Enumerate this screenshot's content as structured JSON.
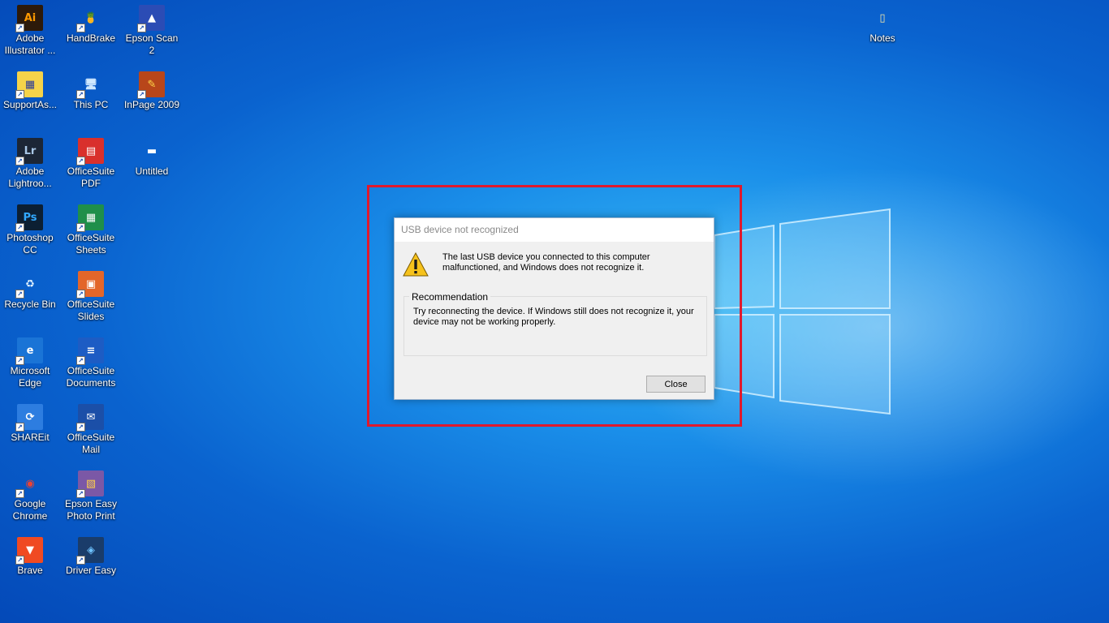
{
  "desktop": {
    "icons": [
      {
        "label": "Adobe Illustrator ...",
        "icon": "illustrator-icon",
        "glyph": "Ai",
        "color": "#2d1a0a",
        "fg": "#ff9a00"
      },
      {
        "label": "HandBrake",
        "icon": "handbrake-icon",
        "glyph": "🍍",
        "color": "transparent",
        "fg": "#e0a020"
      },
      {
        "label": "Epson Scan 2",
        "icon": "scanner-icon",
        "glyph": "▲",
        "color": "#2b4cb5",
        "fg": "#ffffff"
      },
      {
        "label": "SupportAs...",
        "icon": "support-assist-icon",
        "glyph": "▦",
        "color": "#f5d34a",
        "fg": "#2a3a9a"
      },
      {
        "label": "This PC",
        "icon": "computer-icon",
        "glyph": "🖥",
        "color": "transparent",
        "fg": "#cfe8ff"
      },
      {
        "label": "InPage 2009",
        "icon": "inpage-icon",
        "glyph": "✎",
        "color": "#b8461a",
        "fg": "#ffd84a"
      },
      {
        "label": "Adobe Lightroo...",
        "icon": "lightroom-icon",
        "glyph": "Lr",
        "color": "#1c2636",
        "fg": "#a9c7e6"
      },
      {
        "label": "OfficeSuite PDF",
        "icon": "pdf-icon",
        "glyph": "▤",
        "color": "#d9302c",
        "fg": "#ffffff"
      },
      {
        "label": "Untitled",
        "icon": "folder-icon",
        "glyph": "▬",
        "color": "transparent",
        "fg": "#ffffff"
      },
      {
        "label": "Photoshop CC",
        "icon": "photoshop-icon",
        "glyph": "Ps",
        "color": "#0c1f33",
        "fg": "#31a8ff"
      },
      {
        "label": "OfficeSuite Sheets",
        "icon": "sheets-icon",
        "glyph": "▦",
        "color": "#1f8f4a",
        "fg": "#ffffff"
      },
      {
        "label": "Recycle Bin",
        "icon": "recycle-bin-icon",
        "glyph": "♻",
        "color": "transparent",
        "fg": "#dff1ff"
      },
      {
        "label": "OfficeSuite Slides",
        "icon": "slides-icon",
        "glyph": "▣",
        "color": "#e3662a",
        "fg": "#ffffff"
      },
      {
        "label": "Microsoft Edge",
        "icon": "edge-icon",
        "glyph": "e",
        "color": "#1a74d6",
        "fg": "#ffffff"
      },
      {
        "label": "OfficeSuite Documents",
        "icon": "documents-icon",
        "glyph": "≡",
        "color": "#1d5cc4",
        "fg": "#ffffff"
      },
      {
        "label": "SHAREit",
        "icon": "shareit-icon",
        "glyph": "⟳",
        "color": "#2d7de0",
        "fg": "#ffffff"
      },
      {
        "label": "OfficeSuite Mail",
        "icon": "mail-icon",
        "glyph": "✉",
        "color": "#1b4fa8",
        "fg": "#ffffff"
      },
      {
        "label": "Google Chrome",
        "icon": "chrome-icon",
        "glyph": "◉",
        "color": "transparent",
        "fg": "#e94235"
      },
      {
        "label": "Epson Easy Photo Print",
        "icon": "photo-print-icon",
        "glyph": "▧",
        "color": "#7b58a6",
        "fg": "#ffd24a"
      },
      {
        "label": "Brave",
        "icon": "brave-icon",
        "glyph": "▼",
        "color": "#f04a22",
        "fg": "#ffffff"
      },
      {
        "label": "Driver Easy",
        "icon": "driver-easy-icon",
        "glyph": "◈",
        "color": "#1a3c6a",
        "fg": "#6fc3ff"
      },
      {
        "label": "Notes",
        "icon": "notes-file-icon",
        "glyph": "▯",
        "color": "transparent",
        "fg": "#f5e6a8"
      }
    ]
  },
  "dialog": {
    "title": "USB device not recognized",
    "message": "The last USB device you connected to this computer malfunctioned, and Windows does not recognize it.",
    "recommendation_label": "Recommendation",
    "recommendation_text": "Try reconnecting the device. If Windows still does not recognize it, your device may not be working properly.",
    "close_label": "Close"
  },
  "colors": {
    "highlight": "#e0192d",
    "desktop_accent": "#1a8ee9"
  }
}
